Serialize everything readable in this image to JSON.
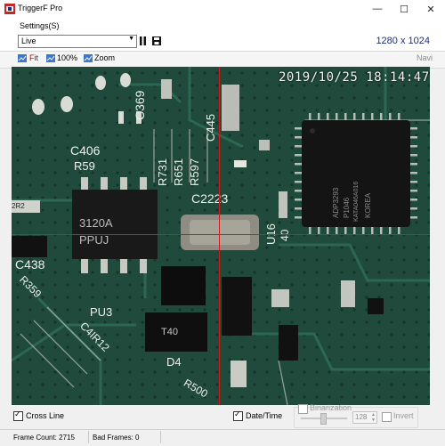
{
  "window": {
    "title": "TriggerF Pro",
    "minimize_icon": "minimize-icon",
    "maximize_icon": "maximize-icon",
    "close_icon": "close-icon",
    "minimize_glyph": "—",
    "maximize_glyph": "☐",
    "close_glyph": "✕"
  },
  "menu": {
    "settings": "Settings(S)"
  },
  "controls": {
    "mode": "Live",
    "resolution": "1280 x 1024",
    "pause_icon": "pause-icon",
    "save_icon": "save-icon"
  },
  "toolbar": {
    "fit": "Fit",
    "zoom100": "100%",
    "zoom": "Zoom",
    "navi": "Navi"
  },
  "overlay": {
    "timestamp": "2019/10/25 18:14:47"
  },
  "board_labels": {
    "c406": "C406",
    "r59": "R59",
    "c369": "C369",
    "r731": "R731",
    "r651": "R651",
    "r597": "R597",
    "c445": "C445",
    "c2223": "C2223",
    "u16": "U16",
    "ic_3120a": "3120A",
    "ic_ppuj": "PPUJ",
    "c438": "C438",
    "pu3": "PU3",
    "r359": "R359",
    "c4ir12": "C4IR12",
    "d4": "D4",
    "r500": "R500",
    "t40": "T40",
    "chip_a": "ADP3293",
    "chip_b": "P1046",
    "chip_c": "KATA046A016",
    "chip_d": "KOREA",
    "r40": "40",
    "r2r2": "2R2"
  },
  "bottom": {
    "cross_line": "Cross Line",
    "cross_line_checked": true,
    "date_time": "Date/Time",
    "date_time_checked": true,
    "binarization": "Binarization",
    "binarization_checked": false,
    "threshold": "128",
    "invert": "Invert",
    "invert_checked": false,
    "slider_level": 0.5
  },
  "status": {
    "frame_count": "Frame Count: 2715",
    "bad_frames": "Bad Frames: 0"
  },
  "colors": {
    "accent": "#1b2d80",
    "crossline": "#d11a1a",
    "pcb": "#1f4a3c"
  }
}
